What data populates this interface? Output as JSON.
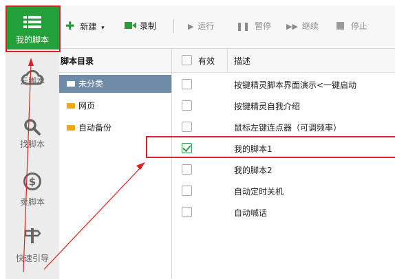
{
  "nav": {
    "items": [
      {
        "label": "我的脚本",
        "icon": "list-icon",
        "active": true
      },
      {
        "label": "云脚本",
        "icon": "cloud-icon"
      },
      {
        "label": "找脚本",
        "icon": "search-icon"
      },
      {
        "label": "卖脚本",
        "icon": "dollar-icon"
      },
      {
        "label": "快速引导",
        "icon": "signpost-icon"
      }
    ]
  },
  "toolbar": {
    "new_label": "新建",
    "record_label": "录制",
    "run_label": "运行",
    "pause_label": "暂停",
    "resume_label": "继续",
    "stop_label": "停止"
  },
  "folders": {
    "header": "脚本目录",
    "items": [
      {
        "name": "未分类",
        "selected": true
      },
      {
        "name": "网页"
      },
      {
        "name": "自动备份"
      }
    ]
  },
  "list": {
    "col_valid": "有效",
    "col_desc": "描述",
    "rows": [
      {
        "desc": "按键精灵脚本界面演示<一键启动",
        "checked": false
      },
      {
        "desc": "按键精灵自我介绍",
        "checked": false
      },
      {
        "desc": "鼠标左键连点器（可调频率）",
        "checked": false
      },
      {
        "desc": "我的脚本1",
        "checked": true
      },
      {
        "desc": "我的脚本2",
        "checked": false
      },
      {
        "desc": "自动定时关机",
        "checked": false
      },
      {
        "desc": "自动喊话",
        "checked": false
      }
    ]
  },
  "colors": {
    "accent_green": "#22a13b",
    "selected_folder": "#6e8ca7",
    "annotation_red": "#e02020",
    "folder_yellow": "#f0a818"
  }
}
